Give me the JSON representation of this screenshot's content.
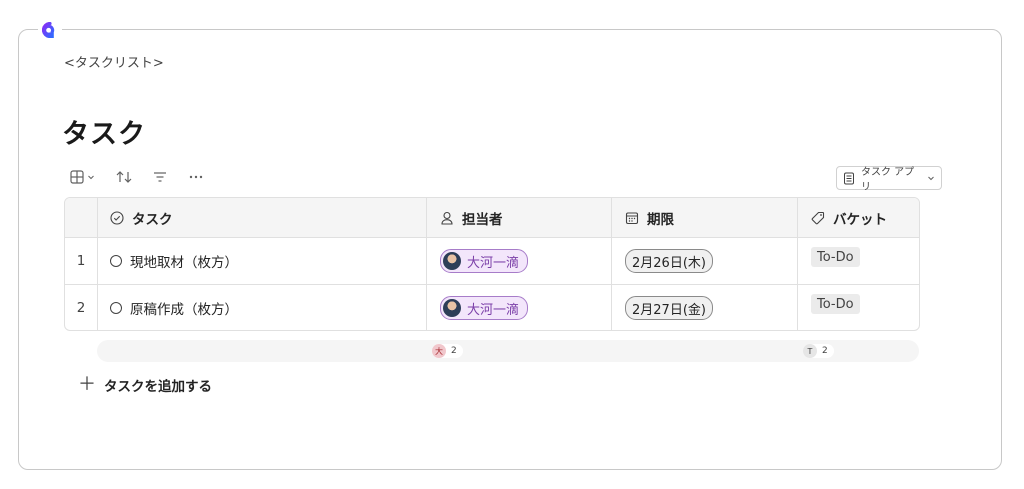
{
  "breadcrumb": "<タスクリスト>",
  "page_title": "タスク",
  "toolbar": {
    "view_icon": "grid-icon",
    "sort_icon": "sort-arrows-icon",
    "filter_icon": "filter-icon",
    "more_icon": "more-icon"
  },
  "app_button": {
    "label": "タスク アプリ",
    "icon": "app-document-icon"
  },
  "columns": {
    "task": "タスク",
    "owner": "担当者",
    "due": "期限",
    "bucket": "バケット"
  },
  "rows": [
    {
      "num": "1",
      "task": "現地取材（枚方）",
      "owner": "大河一滴",
      "due": "2月26日(木)",
      "bucket": "To-Do"
    },
    {
      "num": "2",
      "task": "原稿作成（枚方）",
      "owner": "大河一滴",
      "due": "2月27日(金)",
      "bucket": "To-Do"
    }
  ],
  "summary": {
    "owner_initial": "大",
    "owner_count": "2",
    "bucket_initial": "T",
    "bucket_count": "2"
  },
  "add_task_label": "タスクを追加する",
  "colors": {
    "accent_purple": "#7b3fa8",
    "logo_gradient_start": "#7b2ff7",
    "logo_gradient_end": "#2f6bff"
  }
}
